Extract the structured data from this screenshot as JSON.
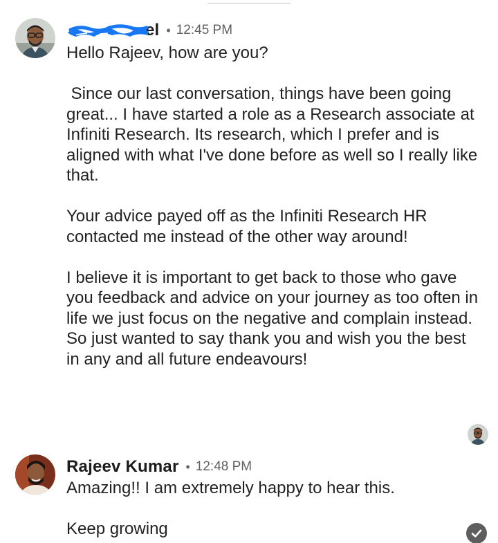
{
  "messages": [
    {
      "sender": "el",
      "separator": "•",
      "time": "12:45 PM",
      "paragraphs": [
        "Hello Rajeev, how are you?",
        " Since our last conversation, things have been going great... I have started a role as a Research associate at Infiniti Research. Its research, which I prefer and is aligned with what I've done before as well so I really like that.",
        "Your advice payed off as the Infiniti Research HR contacted me instead of the other way around!",
        "I believe it is important to get back to those who gave you feedback and advice on your journey as too often in life we just focus on the negative and complain instead. So just wanted to say thank you and wish you the best in any and all future endeavours!"
      ]
    },
    {
      "sender": "Rajeev Kumar",
      "separator": "•",
      "time": "12:48 PM",
      "paragraphs": [
        "Amazing!! I am extremely happy to hear this.",
        "Keep growing"
      ]
    }
  ],
  "colors": {
    "redaction": "#1877f2",
    "receipt_check_bg": "#5e5e5e"
  },
  "icons": {
    "seen": "avatar-seen-receipt-icon",
    "sent": "check-circle-icon"
  }
}
